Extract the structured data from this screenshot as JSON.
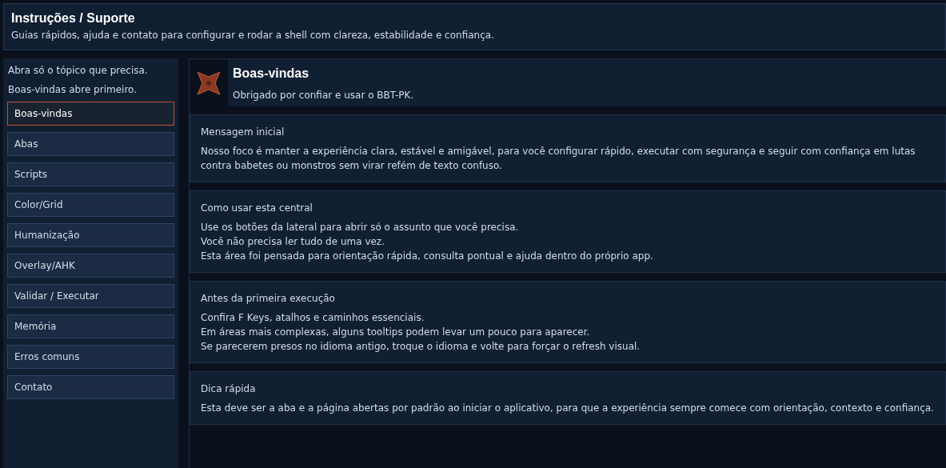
{
  "header": {
    "title": "Instruções / Suporte",
    "subtitle": "Guias rápidos, ajuda e contato para configurar e rodar a shell com clareza, estabilidade e confiança."
  },
  "sidebar": {
    "hints": [
      "Abra só o tópico que precisa.",
      "Boas-vindas abre primeiro."
    ],
    "items": [
      {
        "label": "Boas-vindas",
        "selected": true
      },
      {
        "label": "Abas",
        "selected": false
      },
      {
        "label": "Scripts",
        "selected": false
      },
      {
        "label": "Color/Grid",
        "selected": false
      },
      {
        "label": "Humanização",
        "selected": false
      },
      {
        "label": "Overlay/AHK",
        "selected": false
      },
      {
        "label": "Validar / Executar",
        "selected": false
      },
      {
        "label": "Memória",
        "selected": false
      },
      {
        "label": "Erros comuns",
        "selected": false
      },
      {
        "label": "Contato",
        "selected": false
      }
    ]
  },
  "page": {
    "title": "Boas-vindas",
    "subtitle": "Obrigado por confiar e usar o BBT-PK.",
    "sections": [
      {
        "title": "Mensagem inicial",
        "lines": [
          "Nosso foco é manter a experiência clara, estável e amigável, para você configurar rápido, executar com segurança e seguir com confiança em lutas contra babetes ou monstros sem virar refém de texto confuso."
        ]
      },
      {
        "title": "Como usar esta central",
        "lines": [
          "Use os botões da lateral para abrir só o assunto que você precisa.",
          "Você não precisa ler tudo de uma vez.",
          "Esta área foi pensada para orientação rápida, consulta pontual e ajuda dentro do próprio app."
        ]
      },
      {
        "title": "Antes da primeira execução",
        "lines": [
          "Confira F Keys, atalhos e caminhos essenciais.",
          "Em áreas mais complexas, alguns tooltips podem levar um pouco para aparecer.",
          "Se parecerem presos no idioma antigo, troque o idioma e volte para forçar o refresh visual."
        ]
      },
      {
        "title": "Dica rápida",
        "lines": [
          "Esta deve ser a aba e a página abertas por padrão ao iniciar o aplicativo, para que a experiência sempre comece com orientação, contexto e confiança."
        ]
      }
    ]
  }
}
